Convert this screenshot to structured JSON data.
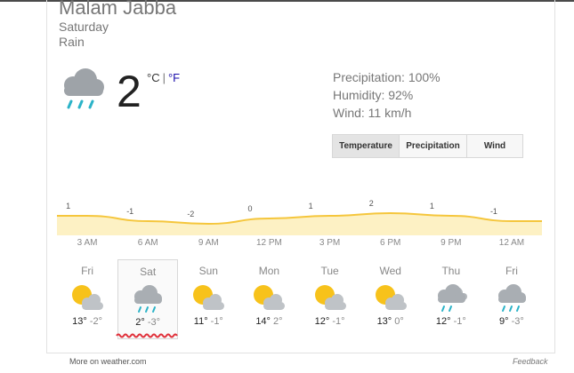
{
  "location": "Malam Jabba",
  "day_label": "Saturday",
  "condition": "Rain",
  "current": {
    "icon": "rain-cloud-icon",
    "temperature": "2",
    "unit_c": "°C",
    "unit_sep": "|",
    "unit_f": "°F"
  },
  "stats": {
    "precipitation": "Precipitation: 100%",
    "humidity": "Humidity: 92%",
    "wind": "Wind: 11 km/h"
  },
  "tabs": [
    {
      "label": "Temperature",
      "active": true
    },
    {
      "label": "Precipitation",
      "active": false
    },
    {
      "label": "Wind",
      "active": false
    }
  ],
  "chart_data": {
    "type": "area",
    "x": [
      "3 AM",
      "6 AM",
      "9 AM",
      "12 PM",
      "3 PM",
      "6 PM",
      "9 PM",
      "12 AM"
    ],
    "values": [
      1,
      -1,
      -2,
      0,
      1,
      2,
      1,
      -1
    ],
    "colors": {
      "fill": "#fdf1c4",
      "line": "#f5c63c"
    }
  },
  "hours": [
    "3 AM",
    "6 AM",
    "9 AM",
    "12 PM",
    "3 PM",
    "6 PM",
    "9 PM",
    "12 AM"
  ],
  "forecast": [
    {
      "day": "Fri",
      "icon": "partly-cloudy-icon",
      "hi": "13°",
      "lo": "-2°",
      "selected": false
    },
    {
      "day": "Sat",
      "icon": "rain-cloud-icon",
      "hi": "2°",
      "lo": "-3°",
      "selected": true
    },
    {
      "day": "Sun",
      "icon": "partly-cloudy-icon",
      "hi": "11°",
      "lo": "-1°",
      "selected": false
    },
    {
      "day": "Mon",
      "icon": "partly-cloudy-icon",
      "hi": "14°",
      "lo": "2°",
      "selected": false
    },
    {
      "day": "Tue",
      "icon": "partly-cloudy-icon",
      "hi": "12°",
      "lo": "-1°",
      "selected": false
    },
    {
      "day": "Wed",
      "icon": "partly-cloudy-icon",
      "hi": "13°",
      "lo": "0°",
      "selected": false
    },
    {
      "day": "Thu",
      "icon": "cloudy-showers-icon",
      "hi": "12°",
      "lo": "-1°",
      "selected": false
    },
    {
      "day": "Fri",
      "icon": "rain-cloud-icon",
      "hi": "9°",
      "lo": "-3°",
      "selected": false
    }
  ],
  "footer": {
    "source_link": "More on weather.com",
    "feedback": "Feedback"
  }
}
